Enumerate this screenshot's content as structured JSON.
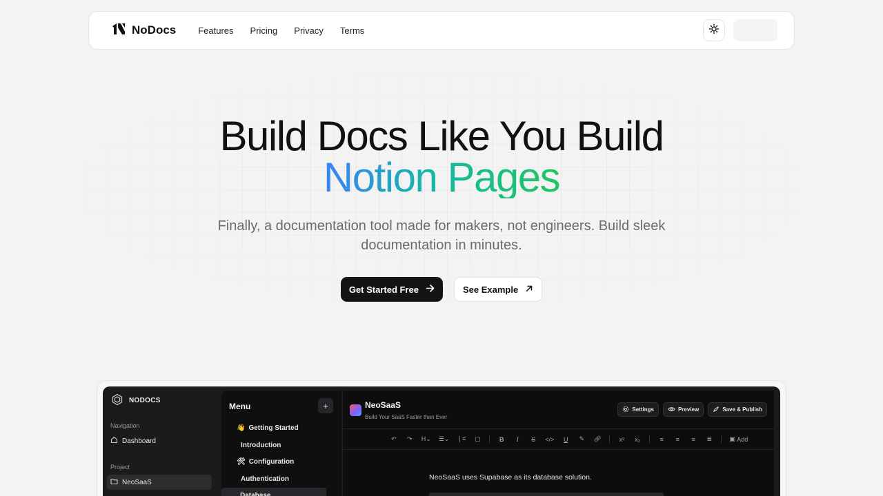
{
  "nav": {
    "brand": "NoDocs",
    "links": [
      "Features",
      "Pricing",
      "Privacy",
      "Terms"
    ]
  },
  "hero": {
    "title_line1": "Build Docs Like You Build",
    "title_line2": "Notion Pages",
    "subtitle": "Finally, a documentation tool made for makers, not engineers. Build sleek documentation in minutes.",
    "primary_cta": "Get Started Free",
    "secondary_cta": "See Example",
    "gradient_colors": [
      "#3b82f6",
      "#14b8a6",
      "#22c55e"
    ]
  },
  "app": {
    "brand": "NODOCS",
    "sidebar": {
      "navigation_label": "Navigation",
      "dashboard": "Dashboard",
      "project_label": "Project",
      "project": "NeoSaaS"
    },
    "menu": {
      "title": "Menu",
      "add": "+",
      "items": [
        {
          "emoji": "👋",
          "label": "Getting Started"
        },
        {
          "emoji": "",
          "label": "Introduction"
        },
        {
          "emoji": "🛠",
          "label": "Configuration"
        },
        {
          "emoji": "",
          "label": "Authentication"
        },
        {
          "emoji": "",
          "label": "Database"
        }
      ]
    },
    "editor": {
      "title": "NeoSaaS",
      "subtitle": "Build Your SaaS Faster than Ever",
      "actions": {
        "settings": "Settings",
        "preview": "Preview",
        "publish": "Save & Publish"
      },
      "toolbar_add": "Add",
      "body_text": "NeoSaaS uses Supabase as its database solution."
    }
  }
}
